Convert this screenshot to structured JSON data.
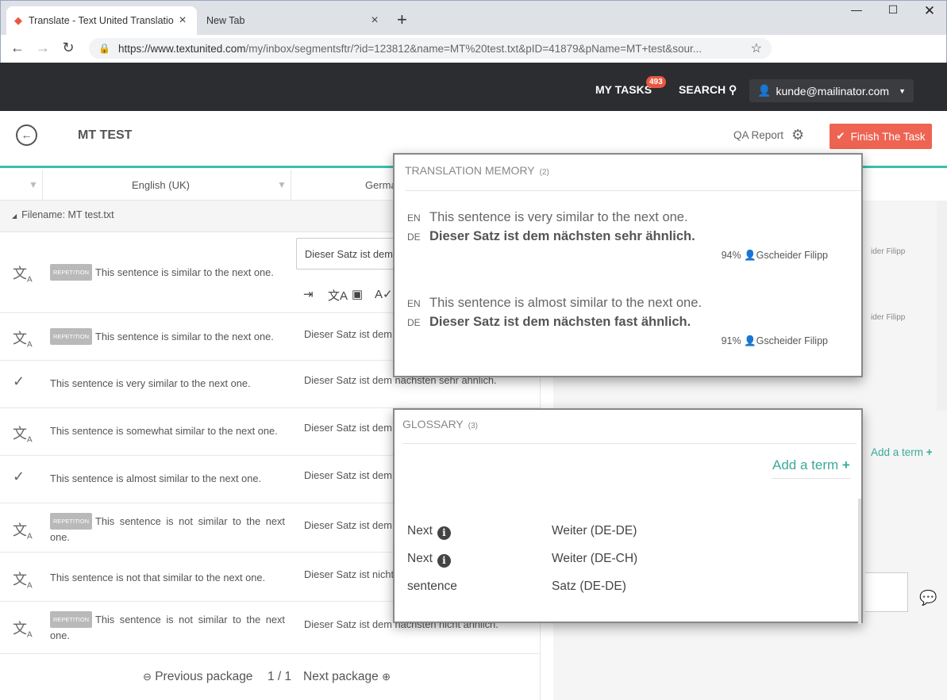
{
  "browser": {
    "tabs": [
      {
        "title": "Translate - Text United Translatio"
      },
      {
        "title": "New Tab"
      }
    ],
    "url_main": "https://www.textunited.com",
    "url_rest": "/my/inbox/segmentsftr/?id=123812&name=MT%20test.txt&pID=41879&pName=MT+test&sour..."
  },
  "header": {
    "my_tasks": "MY TASKS",
    "badge": "493",
    "search": "SEARCH",
    "user": "kunde@mailinator.com"
  },
  "task": {
    "title": "MT TEST",
    "qa_report": "QA Report",
    "finish": "Finish The Task"
  },
  "grid": {
    "col_source": "English (UK)",
    "col_target": "Germa",
    "filename": "Filename: MT test.txt",
    "rep_label": "REPETITION",
    "edit_value": "Dieser Satz ist dem",
    "rows": [
      {
        "src": "This sentence is similar to the next one."
      },
      {
        "src": "This sentence is similar to the next one.",
        "tgt": "Dieser Satz ist dem"
      },
      {
        "src": "This sentence is very similar to the next one.",
        "tgt": "Dieser Satz ist dem nächsten sehr ähnlich."
      },
      {
        "src": "This sentence is somewhat similar to the next one.",
        "tgt": "Dieser Satz ist dem"
      },
      {
        "src": "This sentence is almost similar to the next one.",
        "tgt": "Dieser Satz ist dem"
      },
      {
        "src": "This sentence is not similar to the next one.",
        "tgt": "Dieser Satz ist dem"
      },
      {
        "src": "This sentence is not that similar to the next one.",
        "tgt": "Dieser Satz ist nicht"
      },
      {
        "src": "This sentence is not similar to the next one.",
        "tgt": "Dieser Satz ist dem nächsten nicht ähnlich."
      }
    ],
    "prev": "Previous package",
    "page": "1 / 1",
    "next": "Next package"
  },
  "right_panel": {
    "ghost_author": "ider Filipp",
    "add_term": "Add a term"
  },
  "tm": {
    "title": "TRANSLATION MEMORY",
    "count": "(2)",
    "entries": [
      {
        "src_lang": "EN",
        "src": "This sentence is very similar to the next one.",
        "tgt_lang": "DE",
        "tgt": "Dieser Satz ist dem nächsten sehr ähnlich.",
        "score": "94%",
        "author": "Gscheider Filipp"
      },
      {
        "src_lang": "EN",
        "src": "This sentence is almost similar to the next one.",
        "tgt_lang": "DE",
        "tgt": "Dieser Satz ist dem nächsten fast ähnlich.",
        "score": "91%",
        "author": "Gscheider Filipp"
      }
    ]
  },
  "glossary": {
    "title": "GLOSSARY",
    "count": "(3)",
    "add_term": "Add a term",
    "terms": [
      {
        "term": "Next",
        "translation": "Weiter (DE-DE)"
      },
      {
        "term": "Next",
        "translation": "Weiter (DE-CH)"
      },
      {
        "term": "sentence",
        "translation": "Satz (DE-DE)"
      }
    ]
  }
}
